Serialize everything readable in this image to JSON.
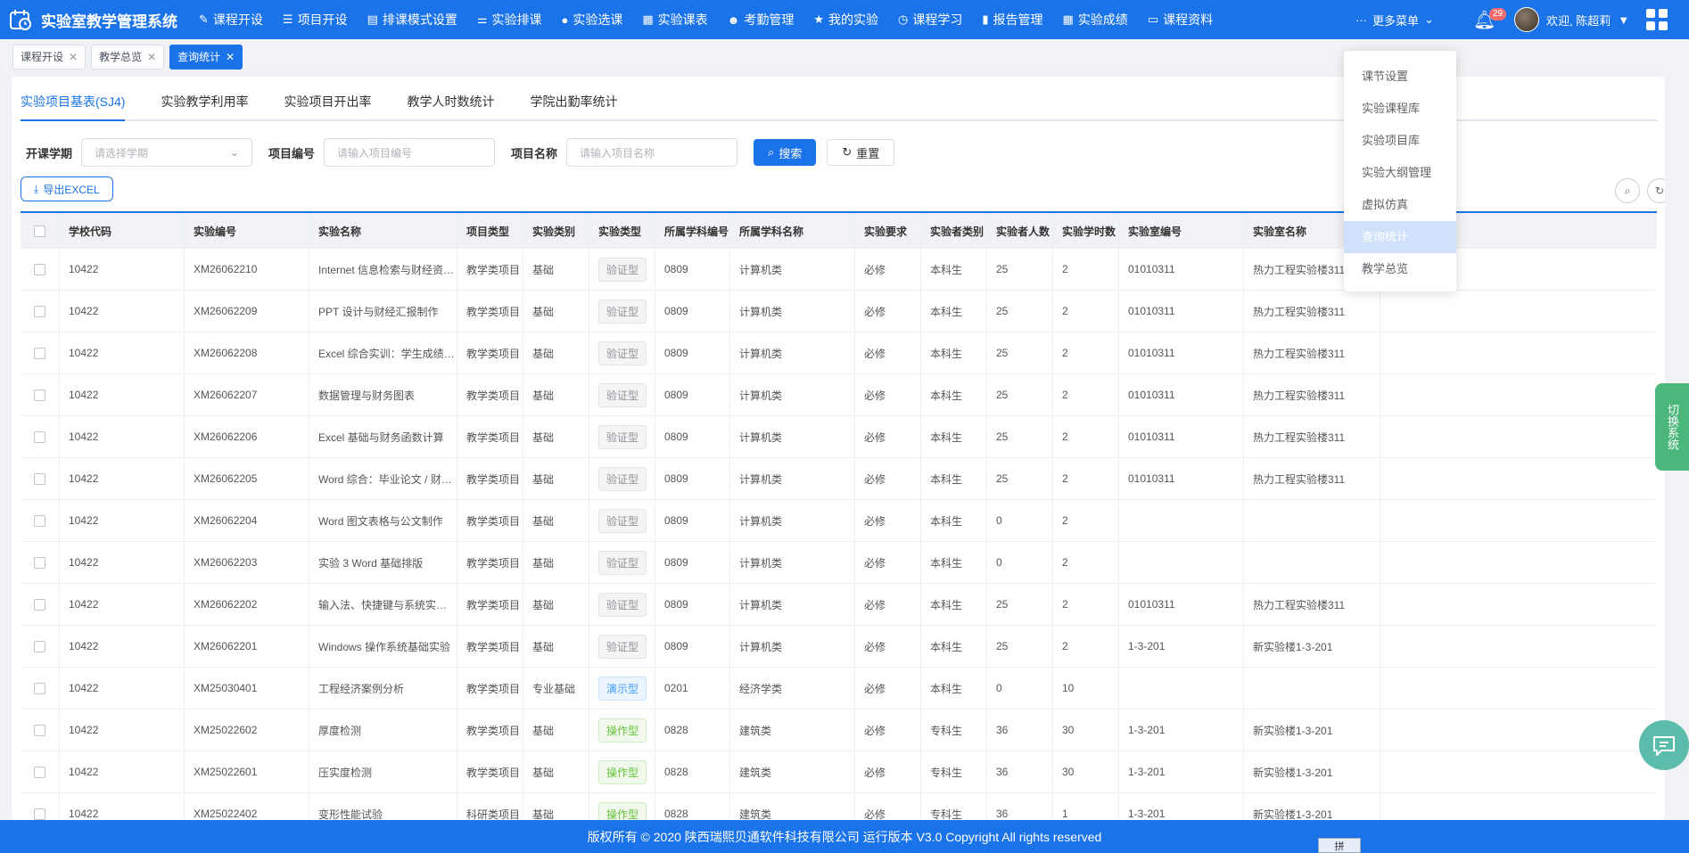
{
  "app": {
    "title": "实验室教学管理系统"
  },
  "nav": [
    {
      "label": "课程开设",
      "icon": "edit-icon",
      "glyph": "✎"
    },
    {
      "label": "项目开设",
      "icon": "list-icon",
      "glyph": "☰"
    },
    {
      "label": "排课模式设置",
      "icon": "document-icon",
      "glyph": "▤"
    },
    {
      "label": "实验排课",
      "icon": "sliders-icon",
      "glyph": "⚌"
    },
    {
      "label": "实验选课",
      "icon": "user-icon",
      "glyph": "●"
    },
    {
      "label": "实验课表",
      "icon": "schedule-icon",
      "glyph": "▦"
    },
    {
      "label": "考勤管理",
      "icon": "attendance-icon",
      "glyph": "☻"
    },
    {
      "label": "我的实验",
      "icon": "star-icon",
      "glyph": "★"
    },
    {
      "label": "课程学习",
      "icon": "clock-icon",
      "glyph": "◷"
    },
    {
      "label": "报告管理",
      "icon": "report-icon",
      "glyph": "▮"
    },
    {
      "label": "实验成绩",
      "icon": "table-icon",
      "glyph": "▦"
    },
    {
      "label": "课程资料",
      "icon": "monitor-icon",
      "glyph": "▭"
    }
  ],
  "header": {
    "more_label": "更多菜单",
    "notification_count": "29",
    "welcome": "欢迎, 陈超莉"
  },
  "tags": [
    {
      "label": "课程开设",
      "active": false
    },
    {
      "label": "教学总览",
      "active": false
    },
    {
      "label": "查询统计",
      "active": true
    }
  ],
  "subtabs": [
    {
      "label": "实验项目基表(SJ4)",
      "active": true
    },
    {
      "label": "实验教学利用率",
      "active": false
    },
    {
      "label": "实验项目开出率",
      "active": false
    },
    {
      "label": "教学人时数统计",
      "active": false
    },
    {
      "label": "学院出勤率统计",
      "active": false
    }
  ],
  "filters": {
    "term_label": "开课学期",
    "term_placeholder": "请选择学期",
    "code_label": "项目编号",
    "code_placeholder": "请输入项目编号",
    "name_label": "项目名称",
    "name_placeholder": "请输入项目名称",
    "search_label": "搜索",
    "reset_label": "重置"
  },
  "export_label": "导出EXCEL",
  "table": {
    "columns": [
      "学校代码",
      "实验编号",
      "实验名称",
      "项目类型",
      "实验类别",
      "实验类型",
      "所属学科编号",
      "所属学科名称",
      "实验要求",
      "实验者类别",
      "实验者人数",
      "实验学时数",
      "实验室编号",
      "实验室名称"
    ],
    "rows": [
      [
        "10422",
        "XM26062210",
        "Internet 信息检索与财经资源查...",
        "教学类项目",
        "基础",
        "验证型",
        "0809",
        "计算机类",
        "必修",
        "本科生",
        "25",
        "2",
        "01010311",
        "热力工程实验楼311"
      ],
      [
        "10422",
        "XM26062209",
        "PPT 设计与财经汇报制作",
        "教学类项目",
        "基础",
        "验证型",
        "0809",
        "计算机类",
        "必修",
        "本科生",
        "25",
        "2",
        "01010311",
        "热力工程实验楼311"
      ],
      [
        "10422",
        "XM26062208",
        "Excel 综合实训：学生成绩 / 企...",
        "教学类项目",
        "基础",
        "验证型",
        "0809",
        "计算机类",
        "必修",
        "本科生",
        "25",
        "2",
        "01010311",
        "热力工程实验楼311"
      ],
      [
        "10422",
        "XM26062207",
        "数据管理与财务图表",
        "教学类项目",
        "基础",
        "验证型",
        "0809",
        "计算机类",
        "必修",
        "本科生",
        "25",
        "2",
        "01010311",
        "热力工程实验楼311"
      ],
      [
        "10422",
        "XM26062206",
        "Excel 基础与财务函数计算",
        "教学类项目",
        "基础",
        "验证型",
        "0809",
        "计算机类",
        "必修",
        "本科生",
        "25",
        "2",
        "01010311",
        "热力工程实验楼311"
      ],
      [
        "10422",
        "XM26062205",
        "Word 综合：毕业论文 / 财务报...",
        "教学类项目",
        "基础",
        "验证型",
        "0809",
        "计算机类",
        "必修",
        "本科生",
        "25",
        "2",
        "01010311",
        "热力工程实验楼311"
      ],
      [
        "10422",
        "XM26062204",
        "Word 图文表格与公文制作",
        "教学类项目",
        "基础",
        "验证型",
        "0809",
        "计算机类",
        "必修",
        "本科生",
        "0",
        "2",
        "",
        ""
      ],
      [
        "10422",
        "XM26062203",
        "实验 3 Word 基础排版",
        "教学类项目",
        "基础",
        "验证型",
        "0809",
        "计算机类",
        "必修",
        "本科生",
        "0",
        "2",
        "",
        ""
      ],
      [
        "10422",
        "XM26062202",
        "输入法、快捷键与系统实用工具",
        "教学类项目",
        "基础",
        "验证型",
        "0809",
        "计算机类",
        "必修",
        "本科生",
        "25",
        "2",
        "01010311",
        "热力工程实验楼311"
      ],
      [
        "10422",
        "XM26062201",
        "Windows 操作系统基础实验",
        "教学类项目",
        "基础",
        "验证型",
        "0809",
        "计算机类",
        "必修",
        "本科生",
        "25",
        "2",
        "1-3-201",
        "新实验楼1-3-201"
      ],
      [
        "10422",
        "XM25030401",
        "工程经济案例分析",
        "教学类项目",
        "专业基础",
        "演示型",
        "0201",
        "经济学类",
        "必修",
        "本科生",
        "0",
        "10",
        "",
        ""
      ],
      [
        "10422",
        "XM25022602",
        "厚度检测",
        "教学类项目",
        "基础",
        "操作型",
        "0828",
        "建筑类",
        "必修",
        "专科生",
        "36",
        "30",
        "1-3-201",
        "新实验楼1-3-201"
      ],
      [
        "10422",
        "XM25022601",
        "压实度检测",
        "教学类项目",
        "基础",
        "操作型",
        "0828",
        "建筑类",
        "必修",
        "专科生",
        "36",
        "30",
        "1-3-201",
        "新实验楼1-3-201"
      ],
      [
        "10422",
        "XM25022402",
        "变形性能试验",
        "科研类项目",
        "基础",
        "操作型",
        "0828",
        "建筑类",
        "必修",
        "专科生",
        "36",
        "1",
        "1-3-201",
        "新实验楼1-3-201"
      ]
    ]
  },
  "dropdown": [
    {
      "label": "课节设置",
      "active": false
    },
    {
      "label": "实验课程库",
      "active": false
    },
    {
      "label": "实验项目库",
      "active": false
    },
    {
      "label": "实验大纲管理",
      "active": false
    },
    {
      "label": "虚拟仿真",
      "active": false
    },
    {
      "label": "查询统计",
      "active": true
    },
    {
      "label": "教学总览",
      "active": false
    }
  ],
  "switch_system": "切换系统",
  "footer": "版权所有 © 2020 陕西瑞熙贝通软件科技有限公司 运行版本 V3.0 Copyright All rights reserved",
  "ime": "拼",
  "colors": {
    "primary": "#1a73e8",
    "switch": "#4cb77b",
    "chat": "#5cbcab"
  }
}
